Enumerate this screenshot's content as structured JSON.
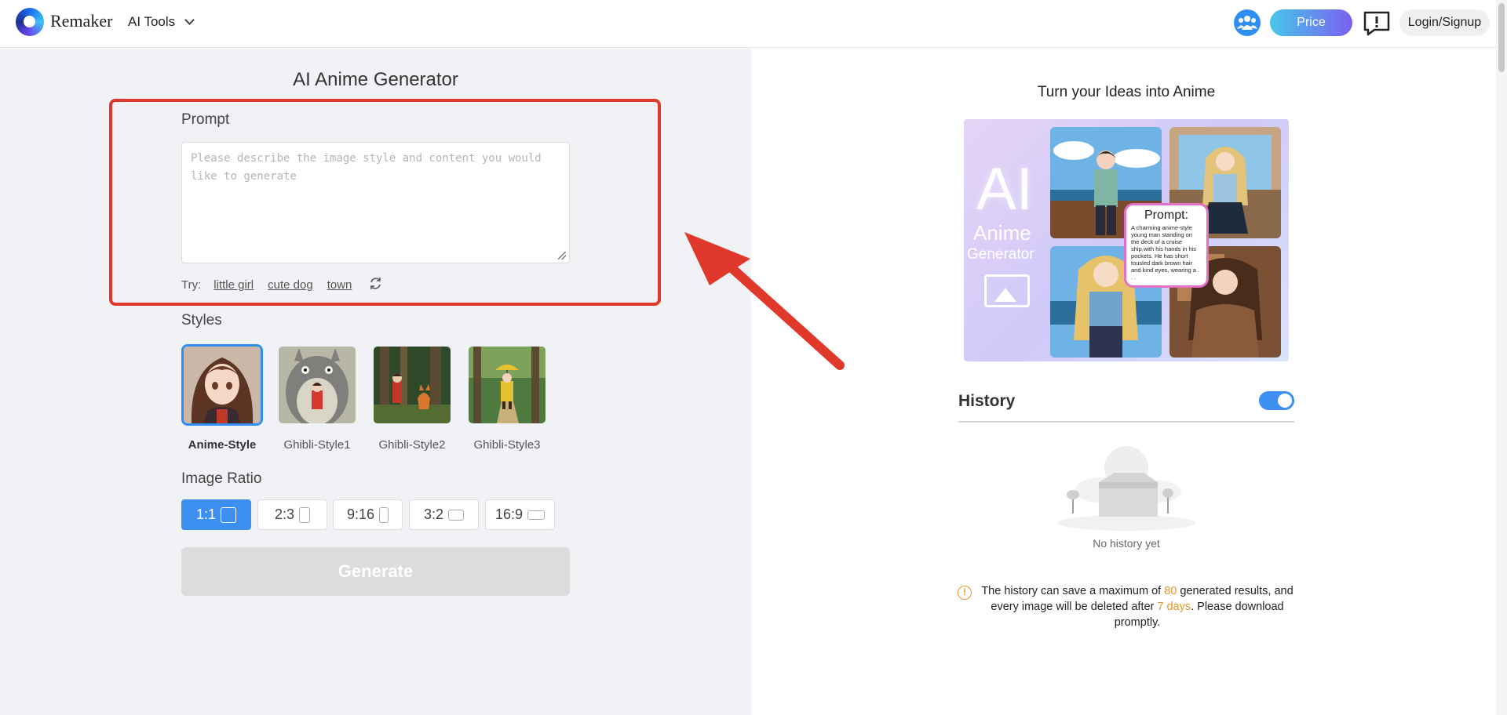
{
  "header": {
    "brand": "Remaker",
    "tools_menu": "AI Tools",
    "price_button": "Price",
    "login_button": "Login/Signup"
  },
  "main": {
    "title": "AI Anime Generator",
    "prompt": {
      "label": "Prompt",
      "value": "",
      "placeholder": "Please describe the image style and content you would like to generate"
    },
    "try": {
      "label": "Try:",
      "suggestions": [
        "little girl",
        "cute dog",
        "town"
      ]
    },
    "styles": {
      "label": "Styles",
      "items": [
        {
          "name": "Anime-Style",
          "selected": true
        },
        {
          "name": "Ghibli-Style1",
          "selected": false
        },
        {
          "name": "Ghibli-Style2",
          "selected": false
        },
        {
          "name": "Ghibli-Style3",
          "selected": false
        }
      ]
    },
    "ratio": {
      "label": "Image Ratio",
      "options": [
        "1:1",
        "2:3",
        "9:16",
        "3:2",
        "16:9"
      ],
      "selected": "1:1"
    },
    "generate_button": "Generate"
  },
  "right": {
    "title": "Turn your Ideas into Anime",
    "preview": {
      "heading_ai": "AI",
      "heading_anime": "Anime",
      "heading_generator": "Generator",
      "bubble_title": "Prompt:",
      "bubble_text": "A charming anime-style young man standing on the deck of a cruise ship,with his hands in his pockets. He has short tousled dark brown hair and kind eyes, wearing a . . ."
    },
    "history": {
      "label": "History",
      "toggle_on": true,
      "empty_text": "No history yet",
      "notice_part1": "The history can save a maximum of ",
      "max_count": "80",
      "notice_part2": " generated results, and every image will be deleted after ",
      "days": "7 days",
      "notice_part3": ". Please download promptly."
    }
  },
  "colors": {
    "accent": "#3d8ff2",
    "highlight": "#e0392b",
    "warning": "#e8952a"
  }
}
